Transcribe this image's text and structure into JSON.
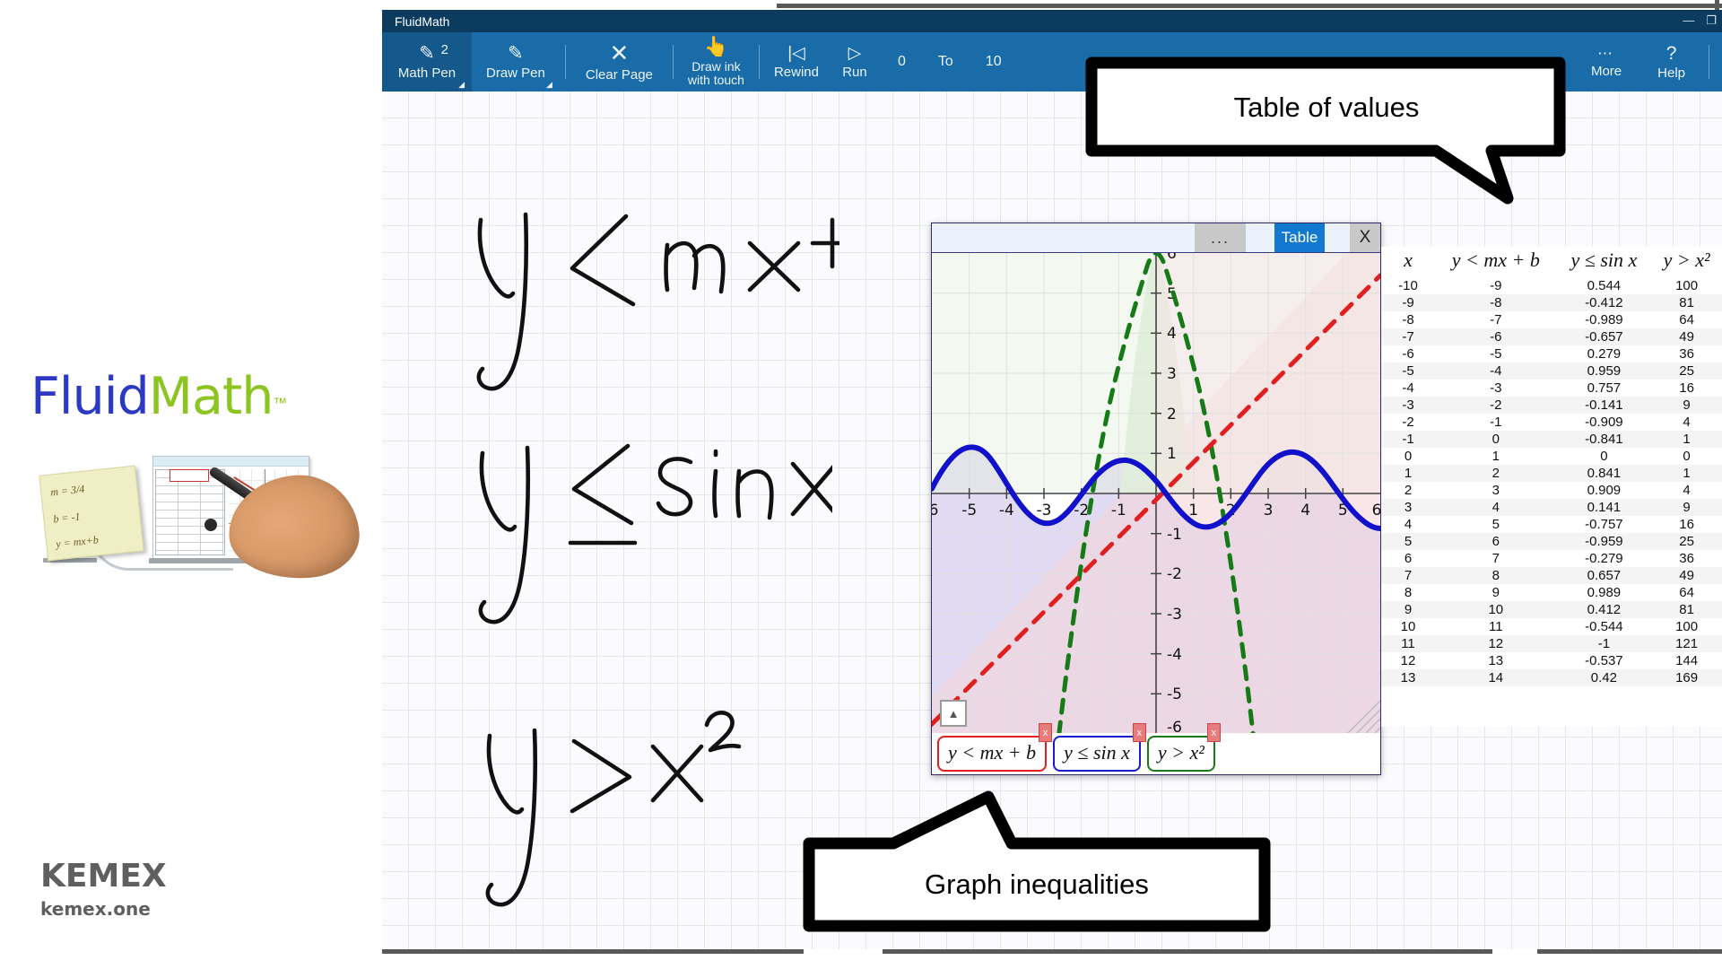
{
  "window": {
    "title": "FluidMath",
    "minimize": "—",
    "restore": "❐"
  },
  "toolbar": {
    "items": [
      {
        "label": "Math Pen",
        "icon": "pencil-icon",
        "badge": "2",
        "caret": true,
        "active": true
      },
      {
        "label": "Draw Pen",
        "icon": "pencil-icon",
        "badge": "",
        "caret": true,
        "active": false
      },
      {
        "label": "Clear Page",
        "icon": "close-x-icon",
        "badge": "",
        "caret": false,
        "active": false
      },
      {
        "label": "Draw ink with touch",
        "icon": "hand-touch-icon",
        "badge": "",
        "caret": false,
        "active": false
      },
      {
        "label": "Rewind",
        "icon": "rewind-icon",
        "badge": "",
        "caret": false,
        "active": false
      },
      {
        "label": "Run",
        "icon": "play-icon",
        "badge": "",
        "caret": false,
        "active": false
      }
    ],
    "range_start": "0",
    "range_to": "To",
    "range_end": "10",
    "more_label": "More",
    "more_icon": "ellipsis-icon",
    "help_label": "Help",
    "help_icon": "question-mark-icon"
  },
  "ink_notes": [
    {
      "text": "y < mx + b"
    },
    {
      "text": "y ≤ sin x"
    },
    {
      "text": "y > x²"
    }
  ],
  "graph_window": {
    "dots_label": "...",
    "table_tab": "Table",
    "close_label": "X",
    "expand_icon": "triangle-up-icon",
    "chips": [
      {
        "label": "y < mx + b",
        "color": "#e02020",
        "close": "x"
      },
      {
        "label": "y ≤ sin x",
        "color": "#1a1ad0",
        "close": "x"
      },
      {
        "label": "y > x²",
        "color": "#1a7a1a",
        "close": "x"
      }
    ]
  },
  "chart_data": {
    "type": "line",
    "title": "",
    "xlabel": "",
    "ylabel": "",
    "xlim": [
      -6,
      6
    ],
    "ylim": [
      -6,
      6
    ],
    "grid": true,
    "legend": "none",
    "x_ticks": [
      -5,
      -4,
      -3,
      -2,
      -1,
      1,
      2,
      3,
      4,
      5
    ],
    "y_ticks": [
      5,
      4,
      3,
      2,
      1,
      -1,
      -2,
      -3,
      -4,
      -5
    ],
    "series": [
      {
        "name": "y < mx + b",
        "style": "dashed",
        "color": "#e02020",
        "shade": "#f7d8d8",
        "equation": "y = x + 1"
      },
      {
        "name": "y ≤ sin x",
        "style": "solid",
        "color": "#1111cc",
        "shade": "#ded8f0",
        "equation": "y = sin(x)"
      },
      {
        "name": "y > x²",
        "style": "dashed",
        "color": "#167a16",
        "shade": "#dff0dc",
        "equation": "y = x^2"
      }
    ]
  },
  "table": {
    "headers": [
      "x",
      "y < mx + b",
      "y ≤ sin x",
      "y > x²"
    ],
    "rows": [
      [
        "-10",
        "-9",
        "0.544",
        "100"
      ],
      [
        "-9",
        "-8",
        "-0.412",
        "81"
      ],
      [
        "-8",
        "-7",
        "-0.989",
        "64"
      ],
      [
        "-7",
        "-6",
        "-0.657",
        "49"
      ],
      [
        "-6",
        "-5",
        "0.279",
        "36"
      ],
      [
        "-5",
        "-4",
        "0.959",
        "25"
      ],
      [
        "-4",
        "-3",
        "0.757",
        "16"
      ],
      [
        "-3",
        "-2",
        "-0.141",
        "9"
      ],
      [
        "-2",
        "-1",
        "-0.909",
        "4"
      ],
      [
        "-1",
        "0",
        "-0.841",
        "1"
      ],
      [
        "0",
        "1",
        "0",
        "0"
      ],
      [
        "1",
        "2",
        "0.841",
        "1"
      ],
      [
        "2",
        "3",
        "0.909",
        "4"
      ],
      [
        "3",
        "4",
        "0.141",
        "9"
      ],
      [
        "4",
        "5",
        "-0.757",
        "16"
      ],
      [
        "5",
        "6",
        "-0.959",
        "25"
      ],
      [
        "6",
        "7",
        "-0.279",
        "36"
      ],
      [
        "7",
        "8",
        "0.657",
        "49"
      ],
      [
        "8",
        "9",
        "0.989",
        "64"
      ],
      [
        "9",
        "10",
        "0.412",
        "81"
      ],
      [
        "10",
        "11",
        "-0.544",
        "100"
      ],
      [
        "11",
        "12",
        "-1",
        "121"
      ],
      [
        "12",
        "13",
        "-0.537",
        "144"
      ],
      [
        "13",
        "14",
        "0.42",
        "169"
      ]
    ]
  },
  "callouts": {
    "top": "Table of values",
    "bottom": "Graph inequalities"
  },
  "branding": {
    "logo_first": "Fluid",
    "logo_second": "Math",
    "logo_tm": "™",
    "sticky_lines": [
      "m = 3/4",
      "b = -1",
      "y = mx+b"
    ],
    "kemex_name": "KEMEX",
    "kemex_site": "kemex.one"
  },
  "colors": {
    "titlebar": "#0b3c60",
    "toolbar": "#1a6ca8",
    "accent": "#1279d0",
    "logo_blue": "#2b39c4",
    "logo_green": "#8cc520"
  }
}
